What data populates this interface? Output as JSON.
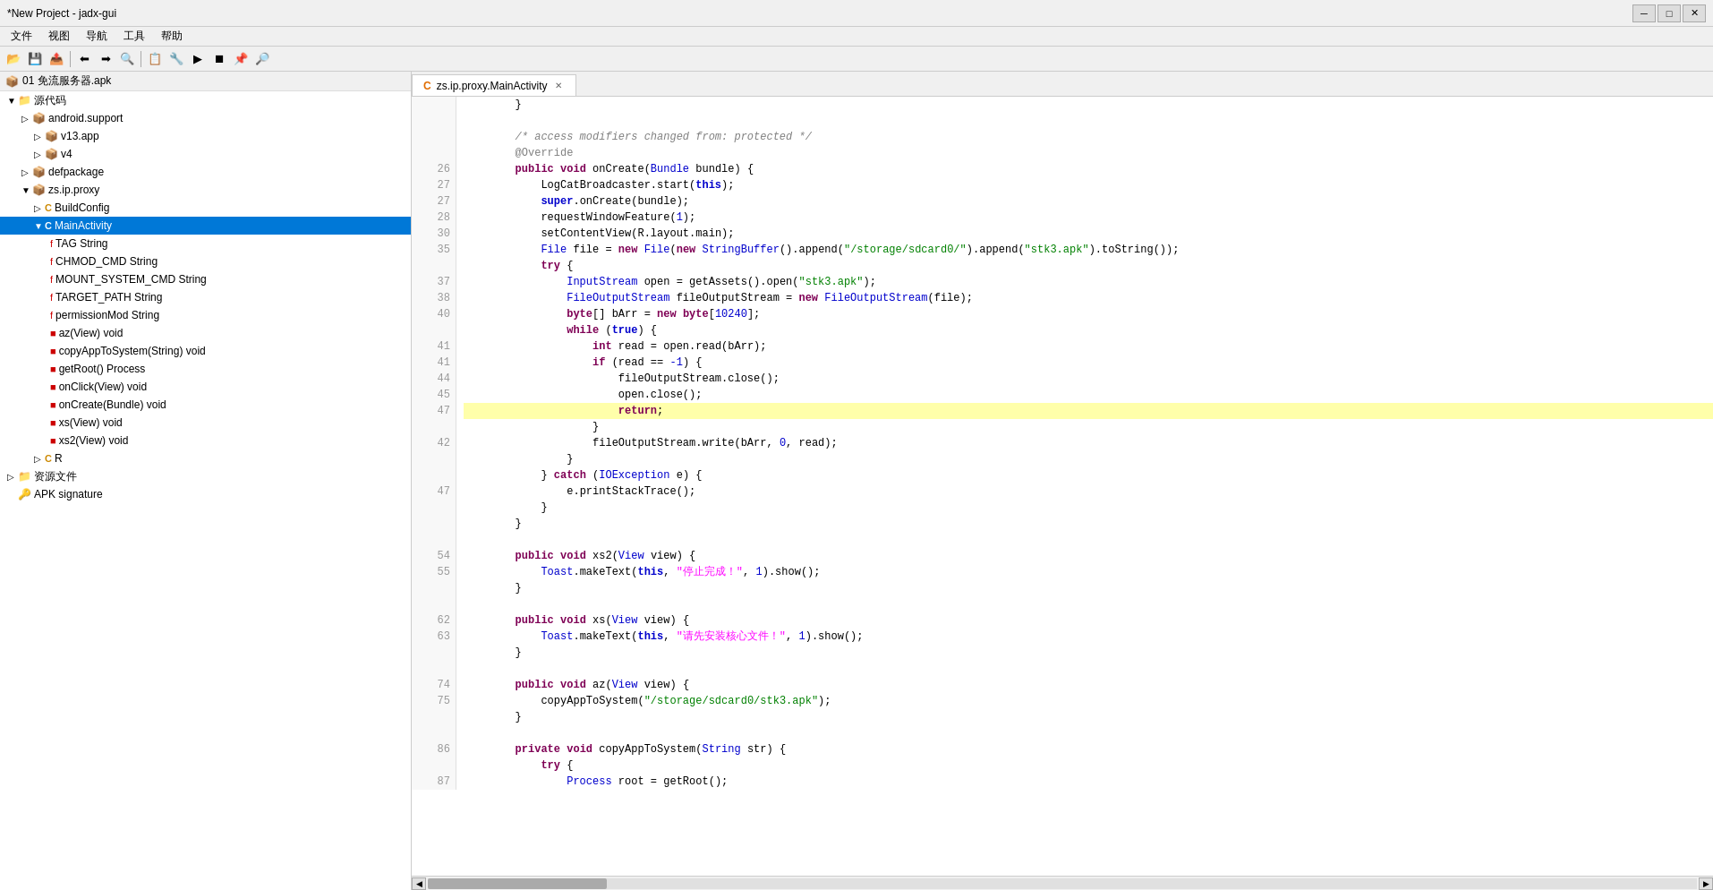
{
  "window": {
    "title": "*New Project - jadx-gui",
    "controls": {
      "minimize": "─",
      "maximize": "□",
      "close": "✕"
    }
  },
  "menubar": {
    "items": [
      "文件",
      "视图",
      "导航",
      "工具",
      "帮助"
    ]
  },
  "toolbar": {
    "buttons": [
      "📂",
      "💾",
      "📤",
      "⟵",
      "⟶",
      "🔍",
      "📋",
      "🔧",
      "▶",
      "⏹",
      "📌",
      "🔎"
    ]
  },
  "sidebar": {
    "apk_label": "01 免流服务器.apk",
    "tree_items": [
      {
        "label": "源代码",
        "indent": 0,
        "icon": "folder",
        "expand": "▼",
        "type": "folder"
      },
      {
        "label": "android.support",
        "indent": 1,
        "icon": "📦",
        "expand": "▷",
        "type": "package"
      },
      {
        "label": "v13.app",
        "indent": 2,
        "icon": "📦",
        "expand": "▷",
        "type": "package"
      },
      {
        "label": "v4",
        "indent": 2,
        "icon": "📦",
        "expand": "▷",
        "type": "package"
      },
      {
        "label": "defpackage",
        "indent": 1,
        "icon": "📦",
        "expand": "▷",
        "type": "package"
      },
      {
        "label": "zs.ip.proxy",
        "indent": 1,
        "icon": "📦",
        "expand": "▼",
        "type": "package"
      },
      {
        "label": "BuildConfig",
        "indent": 2,
        "icon": "C",
        "expand": "▷",
        "type": "class"
      },
      {
        "label": "MainActivity",
        "indent": 2,
        "icon": "C",
        "expand": "▼",
        "type": "class",
        "selected": true
      },
      {
        "label": "TAG String",
        "indent": 3,
        "icon": "f",
        "type": "field"
      },
      {
        "label": "CHMOD_CMD String",
        "indent": 3,
        "icon": "f",
        "type": "field"
      },
      {
        "label": "MOUNT_SYSTEM_CMD String",
        "indent": 3,
        "icon": "f",
        "type": "field"
      },
      {
        "label": "TARGET_PATH String",
        "indent": 3,
        "icon": "f",
        "type": "field"
      },
      {
        "label": "permissionMod String",
        "indent": 3,
        "icon": "f",
        "type": "field"
      },
      {
        "label": "az(View) void",
        "indent": 3,
        "icon": "m",
        "type": "method"
      },
      {
        "label": "copyAppToSystem(String) void",
        "indent": 3,
        "icon": "m",
        "type": "method"
      },
      {
        "label": "getRoot() Process",
        "indent": 3,
        "icon": "m",
        "type": "method"
      },
      {
        "label": "onClick(View) void",
        "indent": 3,
        "icon": "m",
        "type": "method"
      },
      {
        "label": "onCreate(Bundle) void",
        "indent": 3,
        "icon": "m",
        "type": "method"
      },
      {
        "label": "xs(View) void",
        "indent": 3,
        "icon": "m",
        "type": "method"
      },
      {
        "label": "xs2(View) void",
        "indent": 3,
        "icon": "m",
        "type": "method"
      },
      {
        "label": "R",
        "indent": 2,
        "icon": "C",
        "expand": "▷",
        "type": "class"
      },
      {
        "label": "资源文件",
        "indent": 0,
        "icon": "folder",
        "expand": "▷",
        "type": "folder"
      },
      {
        "label": "APK signature",
        "indent": 0,
        "icon": "🔑",
        "type": "apksig"
      }
    ]
  },
  "editor": {
    "tab": {
      "icon": "C",
      "label": "zs.ip.proxy.MainActivity",
      "close": "✕"
    },
    "lines": [
      {
        "num": "",
        "code": "        }",
        "highlight": false
      },
      {
        "num": "",
        "code": "",
        "highlight": false
      },
      {
        "num": "",
        "code": "        /* access modifiers changed from: protected */",
        "highlight": false,
        "style": "comment"
      },
      {
        "num": "",
        "code": "        @Override",
        "highlight": false,
        "style": "annotation"
      },
      {
        "num": "26",
        "code": "        public void onCreate(Bundle bundle) {",
        "highlight": false
      },
      {
        "num": "27",
        "code": "            LogCatBroadcaster.start(this);",
        "highlight": false
      },
      {
        "num": "27",
        "code": "            super.onCreate(bundle);",
        "highlight": false
      },
      {
        "num": "28",
        "code": "            requestWindowFeature(1);",
        "highlight": false
      },
      {
        "num": "30",
        "code": "            setContentView(R.layout.main);",
        "highlight": false
      },
      {
        "num": "35",
        "code": "            File file = new File(new StringBuffer().append(\"/storage/sdcard0/\").append(\"stk3.apk\").toString());",
        "highlight": false
      },
      {
        "num": "",
        "code": "            try {",
        "highlight": false
      },
      {
        "num": "37",
        "code": "                InputStream open = getAssets().open(\"stk3.apk\");",
        "highlight": false
      },
      {
        "num": "38",
        "code": "                FileOutputStream fileOutputStream = new FileOutputStream(file);",
        "highlight": false
      },
      {
        "num": "40",
        "code": "                byte[] bArr = new byte[10240];",
        "highlight": false
      },
      {
        "num": "",
        "code": "                while (true) {",
        "highlight": false
      },
      {
        "num": "41",
        "code": "                    int read = open.read(bArr);",
        "highlight": false
      },
      {
        "num": "41",
        "code": "                    if (read == -1) {",
        "highlight": false
      },
      {
        "num": "44",
        "code": "                        fileOutputStream.close();",
        "highlight": false
      },
      {
        "num": "45",
        "code": "                        open.close();",
        "highlight": false
      },
      {
        "num": "47",
        "code": "                        return;",
        "highlight": true
      },
      {
        "num": "",
        "code": "                    }",
        "highlight": false
      },
      {
        "num": "42",
        "code": "                    fileOutputStream.write(bArr, 0, read);",
        "highlight": false
      },
      {
        "num": "",
        "code": "                }",
        "highlight": false
      },
      {
        "num": "",
        "code": "            } catch (IOException e) {",
        "highlight": false
      },
      {
        "num": "47",
        "code": "                e.printStackTrace();",
        "highlight": false
      },
      {
        "num": "",
        "code": "            }",
        "highlight": false
      },
      {
        "num": "",
        "code": "        }",
        "highlight": false
      },
      {
        "num": "",
        "code": "",
        "highlight": false
      },
      {
        "num": "54",
        "code": "        public void xs2(View view) {",
        "highlight": false
      },
      {
        "num": "55",
        "code": "            Toast.makeText(this, \"停止完成！\", 1).show();",
        "highlight": false
      },
      {
        "num": "",
        "code": "        }",
        "highlight": false
      },
      {
        "num": "",
        "code": "",
        "highlight": false
      },
      {
        "num": "62",
        "code": "        public void xs(View view) {",
        "highlight": false
      },
      {
        "num": "63",
        "code": "            Toast.makeText(this, \"请先安装核心文件！\", 1).show();",
        "highlight": false
      },
      {
        "num": "",
        "code": "        }",
        "highlight": false
      },
      {
        "num": "",
        "code": "",
        "highlight": false
      },
      {
        "num": "74",
        "code": "        public void az(View view) {",
        "highlight": false
      },
      {
        "num": "75",
        "code": "            copyAppToSystem(\"/storage/sdcard0/stk3.apk\");",
        "highlight": false
      },
      {
        "num": "",
        "code": "        }",
        "highlight": false
      },
      {
        "num": "",
        "code": "",
        "highlight": false
      },
      {
        "num": "86",
        "code": "        private void copyAppToSystem(String str) {",
        "highlight": false
      },
      {
        "num": "",
        "code": "            try {",
        "highlight": false
      },
      {
        "num": "87",
        "code": "                Process root = getRoot();",
        "highlight": false
      }
    ]
  },
  "scrollbar": {
    "bottom_label": ""
  }
}
